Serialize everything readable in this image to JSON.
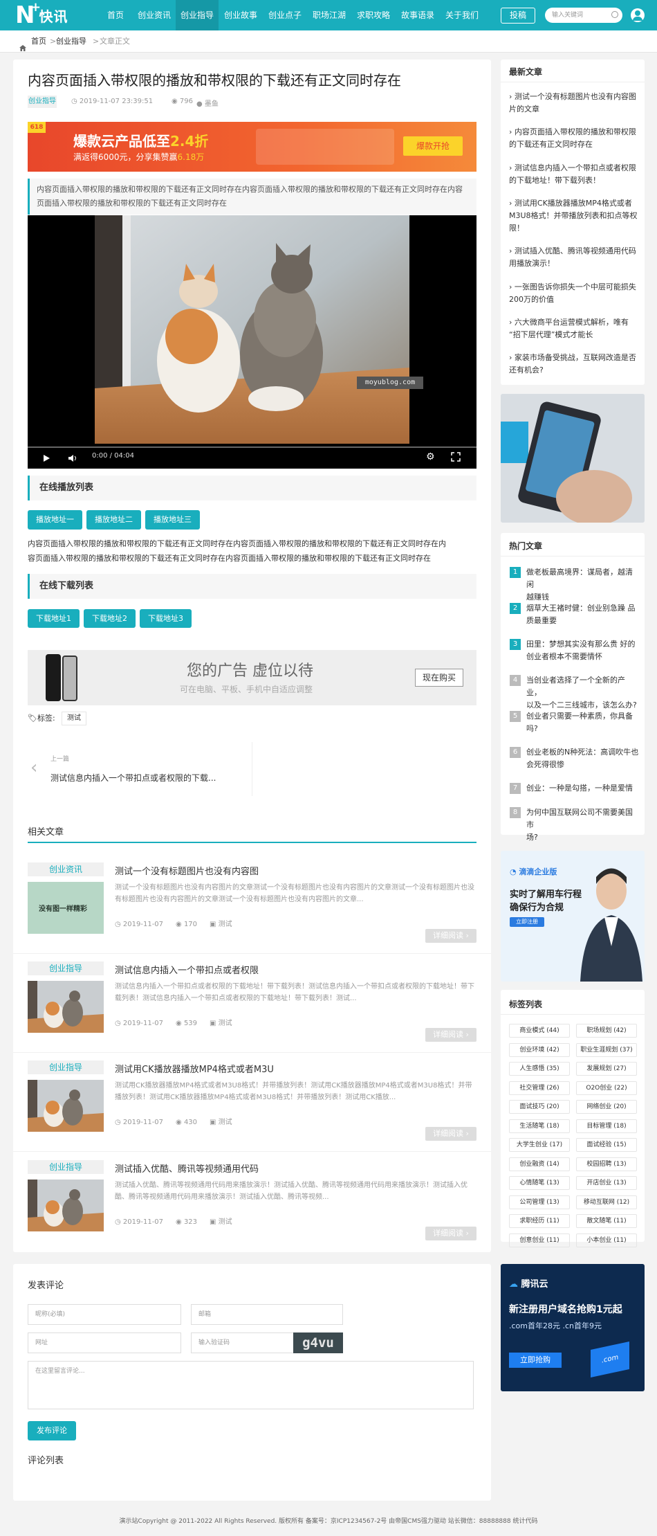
{
  "logo": {
    "letter": "N",
    "cn": "快讯"
  },
  "nav": [
    "首页",
    "创业资讯",
    "创业指导",
    "创业故事",
    "创业点子",
    "职场江湖",
    "求职攻略",
    "故事语录",
    "关于我们"
  ],
  "submit_label": "投稿",
  "search_placeholder": "输入关键词",
  "breadcrumb": {
    "home": "首页",
    "sep1": ">",
    "cat": "创业指导",
    "sep2": ">",
    "current": "文章正文"
  },
  "article": {
    "title": "内容页面插入带权限的播放和带权限的下载还有正文同时存在",
    "category": "创业指导",
    "date": "2019-11-07 23:39:51",
    "views": "796",
    "author": "墨鱼",
    "banner": {
      "badge": "618",
      "headline_prefix": "爆款云产品低至",
      "headline_value": "2.4折",
      "sub_prefix": "满返得6000元，分享集赞赢",
      "sub_value": "6.18万",
      "cta": "爆款开抢"
    },
    "summary": "内容页面插入带权限的播放和带权限的下载还有正文同时存在内容页面插入带权限的播放和带权限的下载还有正文同时存在内容页面插入带权限的播放和带权限的下载还有正文同时存在",
    "video": {
      "watermark": "moyublog.com",
      "time": "0:00 / 04:04",
      "progress": 0
    },
    "play_list_title": "在线播放列表",
    "play_buttons": [
      "播放地址一",
      "播放地址二",
      "播放地址三"
    ],
    "body_line1": "内容页面插入带权限的播放和带权限的下载还有正文同时存在内容页面插入带权限的播放和带权限的下载还有正文同时存在内",
    "body_line2": "容页面插入带权限的播放和带权限的下载还有正文同时存在内容页面插入带权限的播放和带权限的下载还有正文同时存在",
    "download_list_title": "在线下载列表",
    "download_buttons": [
      "下载地址1",
      "下载地址2",
      "下载地址3"
    ],
    "ad": {
      "title": "您的广告 虚位以待",
      "sub": "可在电脑、平板、手机中自适应调整",
      "button": "现在购买"
    },
    "tags_label": "标签:",
    "tags": [
      "测试"
    ],
    "prev": {
      "label": "上一篇",
      "title": "测试信息内插入一个带扣点或者权限的下载..."
    }
  },
  "related": {
    "title": "相关文章",
    "items": [
      {
        "cat": "创业资讯",
        "title": "测试一个没有标题图片也没有内容图",
        "thumb": "没有图一样精彩",
        "excerpt": "测试一个没有标题图片也没有内容图片的文章测试一个没有标题图片也没有内容图片的文章测试一个没有标题图片也没有标题图片也没有内容图片的文章测试一个没有标题图片也没有内容图片的文章...",
        "date": "2019-11-07",
        "views": "170",
        "tag": "测试",
        "more": "详细阅读 ›"
      },
      {
        "cat": "创业指导",
        "title": "测试信息内插入一个带扣点或者权限",
        "thumb": "",
        "excerpt": "测试信息内插入一个带扣点或者权限的下载地址！带下载列表！测试信息内插入一个带扣点或者权限的下载地址！带下载列表！测试信息内插入一个带扣点或者权限的下载地址！带下载列表！测试...",
        "date": "2019-11-07",
        "views": "539",
        "tag": "测试",
        "more": "详细阅读 ›"
      },
      {
        "cat": "创业指导",
        "title": "测试用CK播放器播放MP4格式或者M3U",
        "thumb": "",
        "excerpt": "测试用CK播放器播放MP4格式或者M3U8格式！并带播放列表！测试用CK播放器播放MP4格式或者M3U8格式！并带播放列表！测试用CK播放器播放MP4格式或者M3U8格式！并带播放列表！测试用CK播放...",
        "date": "2019-11-07",
        "views": "430",
        "tag": "测试",
        "more": "详细阅读 ›"
      },
      {
        "cat": "创业指导",
        "title": "测试插入优酷、腾讯等视频通用代码",
        "thumb": "",
        "excerpt": "测试插入优酷、腾讯等视频通用代码用来播放演示！测试插入优酷、腾讯等视频通用代码用来播放演示！测试插入优酷、腾讯等视频通用代码用来播放演示！测试插入优酷、腾讯等视频...",
        "date": "2019-11-07",
        "views": "323",
        "tag": "测试",
        "more": "详细阅读 ›"
      }
    ]
  },
  "comment": {
    "title": "发表评论",
    "name_ph": "昵称(必填)",
    "email_ph": "邮箱",
    "url_ph": "网址",
    "captcha_ph": "输入验证码",
    "captcha": "g4vu",
    "textarea_ph": "在这里留言评论...",
    "submit": "发布评论",
    "list_title": "评论列表"
  },
  "sidebar": {
    "latest_title": "最新文章",
    "latest": [
      [
        "测试一个没有标题图片也没有内容图",
        "片的文章"
      ],
      [
        "内容页面插入带权限的播放和带权限",
        "的下载还有正文同时存在"
      ],
      [
        "测试信息内插入一个带扣点或者权限",
        "的下载地址！带下载列表！"
      ],
      [
        "测试用CK播放器播放MP4格式或者",
        "M3U8格式！并带播放列表和扣点等权",
        "限！"
      ],
      [
        "测试插入优酷、腾讯等视频通用代码",
        "用播放演示！"
      ],
      [
        "一张图告诉你损失一个中层可能损失",
        "200万的价值"
      ],
      [
        "六大微商平台运营模式解析，唯有",
        "“招下层代理”模式才能长"
      ],
      [
        "家装市场备受挑战，互联网改造是否",
        "还有机会?"
      ]
    ],
    "hot_title": "热门文章",
    "hot": [
      [
        "做老板最高境界：谋局者，越清闲",
        "越赚钱"
      ],
      [
        "烟草大王褚时健：创业别急躁 品",
        "质最重要"
      ],
      [
        "田里：梦想其实没有那么贵 好的",
        "创业者根本不需要情怀"
      ],
      [
        "当创业者选择了一个全新的产业，",
        "以及一个二三线城市，该怎么办?"
      ],
      [
        "创业者只需要一种素质，你具备",
        "吗?"
      ],
      [
        "创业老板的N种死法：高调吹牛也",
        "会死得很惨"
      ],
      [
        "创业：一种是勾搭，一种是爱情"
      ],
      [
        "为何中国互联网公司不需要美国市",
        "场?"
      ]
    ],
    "hot_colors": [
      "#19aebd",
      "#19aebd",
      "#19aebd",
      "#bbbbbb",
      "#bbbbbb",
      "#bbbbbb",
      "#bbbbbb",
      "#bbbbbb"
    ],
    "ad2": {
      "brand": "滴滴企业版",
      "line1": "实时了解用车行程",
      "line2": "确保行为合规",
      "btn": "立即注册"
    },
    "tags_title": "标签列表",
    "tags": [
      "商业模式 (44)",
      "职场规划 (42)",
      "创业环境 (42)",
      "职业生涯规划 (37)",
      "人生感悟 (35)",
      "发展规划 (27)",
      "社交管理 (26)",
      "O2O创业 (22)",
      "面试技巧 (20)",
      "网络创业 (20)",
      "生活随笔 (18)",
      "目标管理 (18)",
      "大学生创业 (17)",
      "面试经验 (15)",
      "创业融资 (14)",
      "校园招聘 (13)",
      "心情随笔 (13)",
      "开店创业 (13)",
      "公司管理 (13)",
      "移动互联网 (12)",
      "求职经历 (11)",
      "散文随笔 (11)",
      "创意创业 (11)",
      "小本创业 (11)"
    ],
    "ad3": {
      "brand": "腾讯云",
      "headline": "新注册用户域名抢购1元起",
      "sub": ".com首年28元 .cn首年9元",
      "btn": "立即抢购",
      "badge": ".com"
    }
  },
  "footer": "演示站Copyright @ 2011-2022 All Rights Reserved. 版权所有 备案号：京ICP1234567-2号 由帝国CMS强力驱动 站长微信：88888888 统计代码"
}
